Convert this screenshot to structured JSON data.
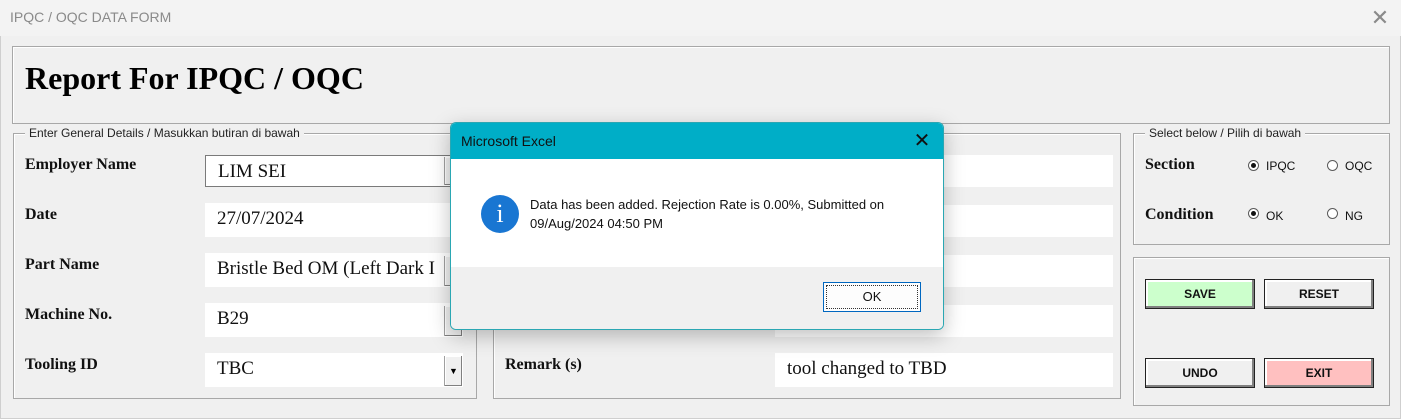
{
  "window": {
    "title": "IPQC / OQC DATA FORM",
    "close_glyph": "✕"
  },
  "header": {
    "title": "Report For IPQC / OQC"
  },
  "general": {
    "caption": "Enter General Details / Masukkan butiran di bawah",
    "employer_label": "Employer Name",
    "employer_value": "LIM SEI",
    "date_label": "Date",
    "date_value": "27/07/2024",
    "part_label": "Part Name",
    "part_value": "Bristle Bed OM (Left Dark I",
    "machine_label": "Machine No.",
    "machine_value": "B29",
    "tooling_label": "Tooling ID",
    "tooling_value": "TBC",
    "dropdown_glyph": "▼"
  },
  "middle": {
    "remark_label": "Remark (s)",
    "remark_value": "tool changed to TBD"
  },
  "select": {
    "caption": "Select below / Pilih di bawah",
    "section_label": "Section",
    "section_options": [
      "IPQC",
      "OQC"
    ],
    "condition_label": "Condition",
    "condition_options": [
      "OK",
      "NG"
    ]
  },
  "buttons": {
    "save": "SAVE",
    "reset": "RESET",
    "undo": "UNDO",
    "exit": "EXIT"
  },
  "colors": {
    "save_bg": "#ccffcc",
    "exit_bg": "#ffc0c0",
    "dialog_title_bg": "#00aec7",
    "info_icon": "#1976d2"
  },
  "dialog": {
    "title": "Microsoft Excel",
    "close_glyph": "✕",
    "icon_glyph": "i",
    "message_line1": "Data has been added. Rejection Rate is 0.00%, Submitted on",
    "message_line2": "09/Aug/2024 04:50 PM",
    "ok_label": "OK"
  }
}
